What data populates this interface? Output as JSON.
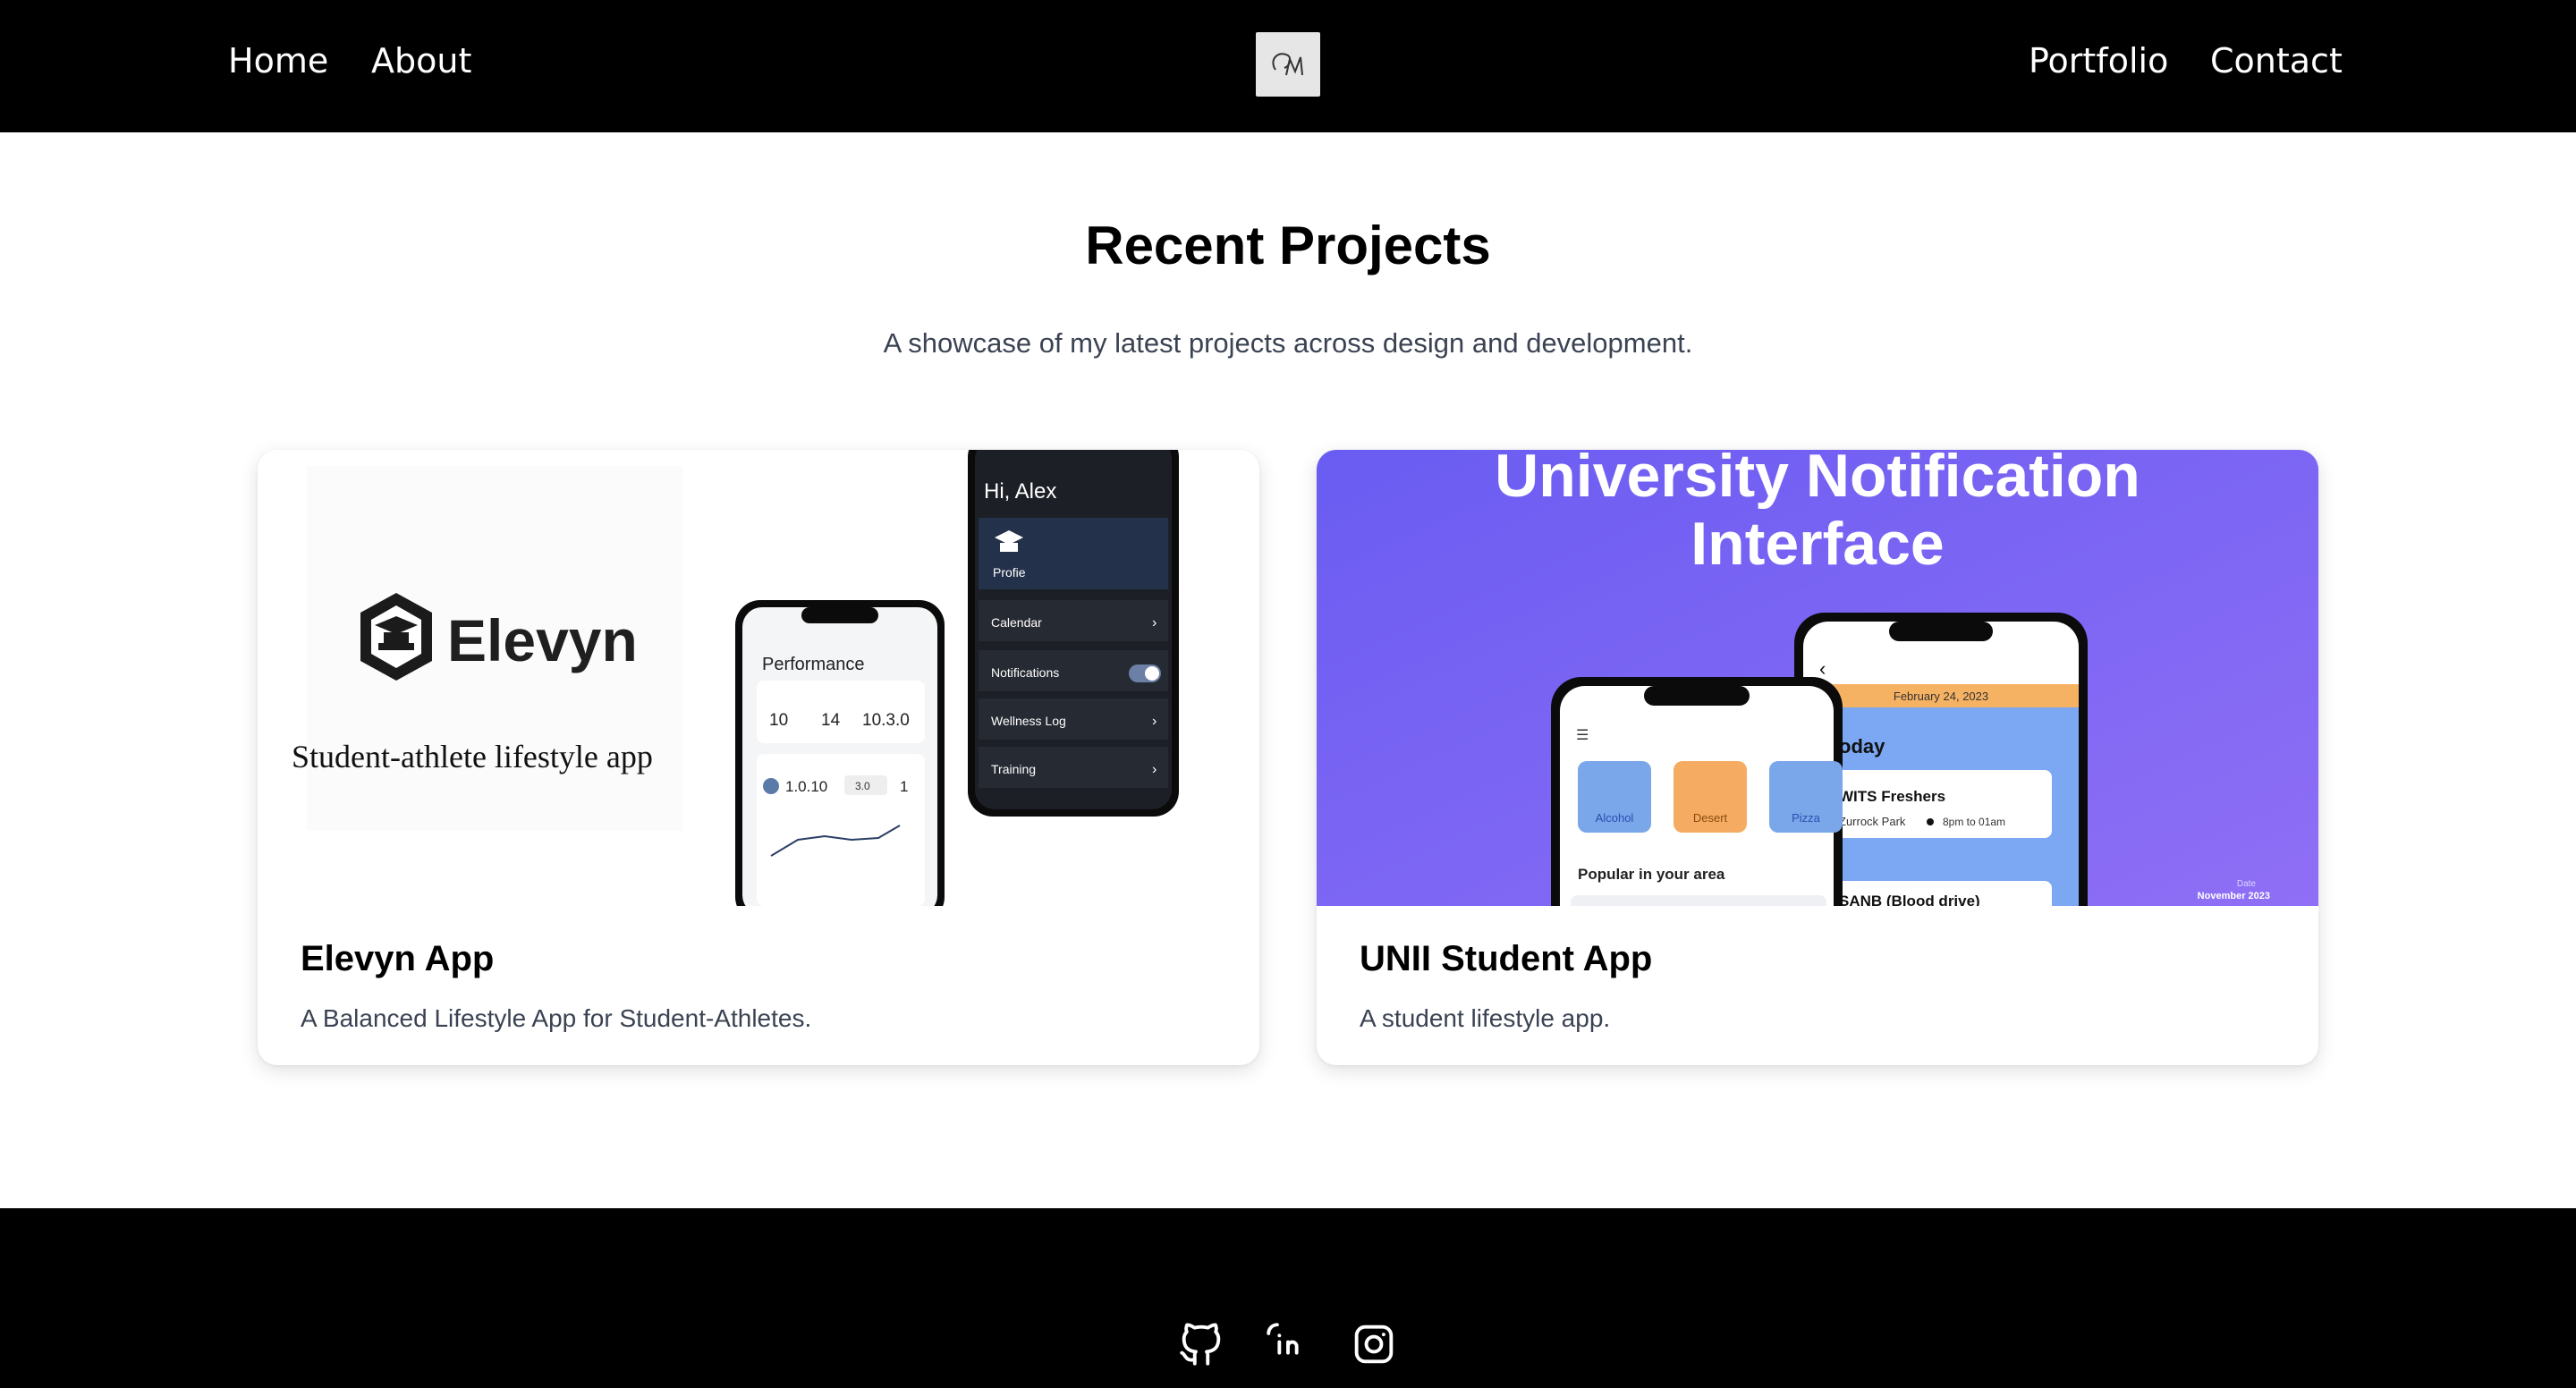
{
  "nav": {
    "home": "Home",
    "about": "About",
    "portfolio": "Portfolio",
    "contact": "Contact",
    "logo_icon": "monogram-logo"
  },
  "header": {
    "title": "Recent Projects",
    "subtitle": "A showcase of my latest projects across design and development."
  },
  "projects": [
    {
      "title": "Elevyn App",
      "description": "A Balanced Lifestyle App for Student-Athletes.",
      "image": {
        "brand": "Elevyn",
        "tagline": "Student-athlete lifestyle app",
        "phone_back": {
          "greeting": "Hi, Alex",
          "profile": "Profie",
          "menu": [
            "Calendar",
            "Notifications",
            "Wellness Log",
            "Training"
          ]
        },
        "phone_front": {
          "heading": "Performance",
          "stats": [
            "10",
            "14",
            "10.3.0"
          ],
          "stress_value": "1.0.10",
          "stress_badge": "3.0",
          "stress_tail": "1"
        }
      }
    },
    {
      "title": "UNII Student App",
      "description": "A student lifestyle app.",
      "image": {
        "headline_1": "University Notification",
        "headline_2": "Interface",
        "bg_color": "#6c5cf0",
        "back_phone": {
          "date": "February 24, 2023",
          "today": "oday",
          "event1_title": "WITS Freshers",
          "event1_place": "Zurrock Park",
          "event1_time": "8pm to 01am",
          "event2_title": "SANB (Blood drive)"
        },
        "front_phone": {
          "categories": [
            "Alcohol",
            "Desert",
            "Pizza"
          ],
          "popular": "Popular in your area"
        },
        "date_label": "Date",
        "date_value": "November 2023"
      }
    }
  ],
  "footer": {
    "icons": [
      "github-icon",
      "linkedin-icon",
      "instagram-icon"
    ]
  }
}
